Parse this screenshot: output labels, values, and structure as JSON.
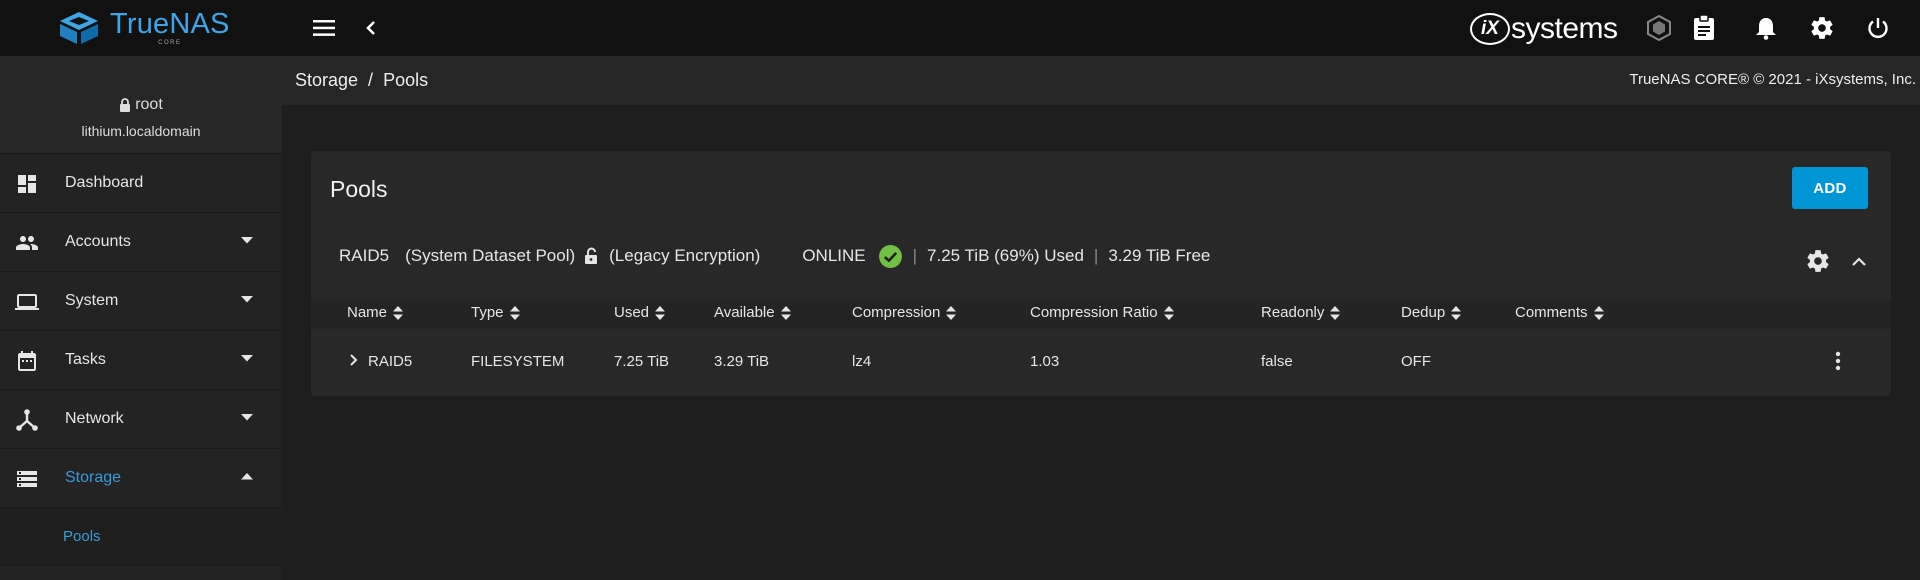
{
  "app": {
    "brand": "TrueNAS",
    "brand_sub": "CORE",
    "vendor_prefix": "iX",
    "vendor_suffix": "systems"
  },
  "user": {
    "name": "root",
    "host": "lithium.localdomain"
  },
  "sidebar": {
    "items": [
      {
        "label": "Dashboard",
        "icon": "dashboard-icon"
      },
      {
        "label": "Accounts",
        "icon": "people-icon"
      },
      {
        "label": "System",
        "icon": "laptop-icon"
      },
      {
        "label": "Tasks",
        "icon": "calendar-icon"
      },
      {
        "label": "Network",
        "icon": "network-icon"
      },
      {
        "label": "Storage",
        "icon": "storage-icon"
      }
    ],
    "sub_item": "Pools"
  },
  "breadcrumb": {
    "parent": "Storage",
    "separator": "/",
    "current": "Pools"
  },
  "copyright": "TrueNAS CORE® © 2021 - iXsystems, Inc.",
  "card": {
    "title": "Pools",
    "add_label": "ADD"
  },
  "pool": {
    "name": "RAID5",
    "system_dataset": "(System Dataset Pool)",
    "encryption": "(Legacy Encryption)",
    "status": "ONLINE",
    "used": "7.25 TiB (69%) Used",
    "free": "3.29 TiB Free",
    "separator": "|"
  },
  "table": {
    "headers": [
      "Name",
      "Type",
      "Used",
      "Available",
      "Compression",
      "Compression Ratio",
      "Readonly",
      "Dedup",
      "Comments"
    ],
    "row": {
      "name": "RAID5",
      "type": "FILESYSTEM",
      "used": "7.25 TiB",
      "available": "3.29 TiB",
      "compression": "lz4",
      "ratio": "1.03",
      "readonly": "false",
      "dedup": "OFF",
      "comments": ""
    }
  },
  "colors": {
    "accent": "#0095d5",
    "brand": "#3fa5e6",
    "status_ok": "#71bf44"
  }
}
